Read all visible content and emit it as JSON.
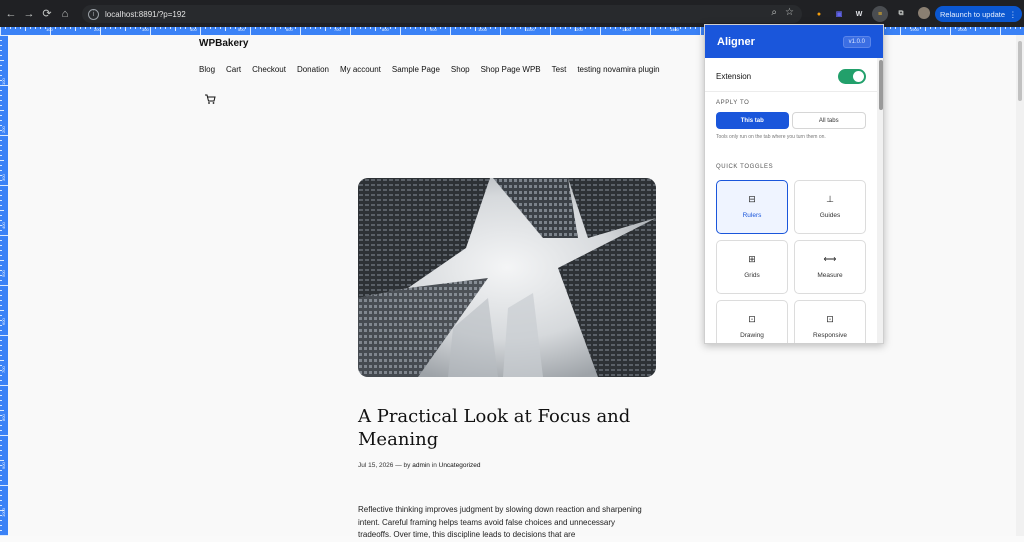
{
  "browser": {
    "url": "localhost:8891/?p=192",
    "relaunch_label": "Relaunch to update",
    "back_icon": "←",
    "forward_icon": "→",
    "reload_icon": "⟳",
    "home_icon": "⌂",
    "info_icon": "i",
    "zoom_icon": "⌕",
    "star_icon": "☆",
    "menu_icon": "⋮",
    "extensions": [
      {
        "name": "flame-extension-icon",
        "glyph": "●",
        "color": "#f59e0b"
      },
      {
        "name": "square-extension-icon",
        "glyph": "▣",
        "color": "#6366f1"
      },
      {
        "name": "wp-extension-icon",
        "glyph": "W",
        "color": "#e5e7eb"
      },
      {
        "name": "aligner-extension-icon",
        "glyph": "≡",
        "color": "#fbbf24"
      },
      {
        "name": "puzzle-extension-icon",
        "glyph": "⧉",
        "color": "#c4c7c5"
      }
    ]
  },
  "rulers": {
    "top_labels": [
      "100",
      "200",
      "300",
      "400",
      "500",
      "600",
      "700",
      "800",
      "900",
      "1000",
      "1100",
      "1200",
      "1300",
      "1400",
      "1500",
      "1600",
      "1700",
      "1800",
      "1900",
      "2000"
    ],
    "left_labels": [
      "100",
      "200",
      "300",
      "400",
      "500",
      "600",
      "700",
      "800",
      "900",
      "1000"
    ]
  },
  "site": {
    "title": "WPBakery",
    "menu": [
      "Blog",
      "Cart",
      "Checkout",
      "Donation",
      "My account",
      "Sample Page",
      "Shop",
      "Shop Page WPB",
      "Test",
      "testing novamira plugin"
    ],
    "post": {
      "title": "A Practical Look at Focus and Meaning",
      "date": "Jul 15, 2026",
      "by": "— by",
      "author": "admin",
      "in": "in",
      "category": "Uncategorized",
      "excerpt": "Reflective thinking improves judgment by slowing down reaction and sharpening intent. Careful framing helps teams avoid false choices and unnecessary tradeoffs. Over time, this discipline leads to decisions that are"
    }
  },
  "aligner": {
    "title": "Aligner",
    "version": "v1.0.0",
    "extension_label": "Extension",
    "extension_enabled": true,
    "apply_to_label": "APPLY TO",
    "apply_options": [
      "This tab",
      "All tabs"
    ],
    "apply_selected": "This tab",
    "hint": "Tools only run on the tab where you turn them on.",
    "quick_toggles_label": "QUICK TOGGLES",
    "toggles": [
      {
        "label": "Rulers",
        "icon": "⊟",
        "active": true
      },
      {
        "label": "Guides",
        "icon": "⊥",
        "active": false
      },
      {
        "label": "Grids",
        "icon": "⊞",
        "active": false
      },
      {
        "label": "Measure",
        "icon": "⟷",
        "active": false
      },
      {
        "label": "Drawing",
        "icon": "⊡",
        "active": false
      },
      {
        "label": "Responsive",
        "icon": "⊡",
        "active": false
      }
    ]
  },
  "colors": {
    "ruler": "#3b82f6",
    "accent": "#1a56db",
    "toggle_on": "#22a06b"
  }
}
